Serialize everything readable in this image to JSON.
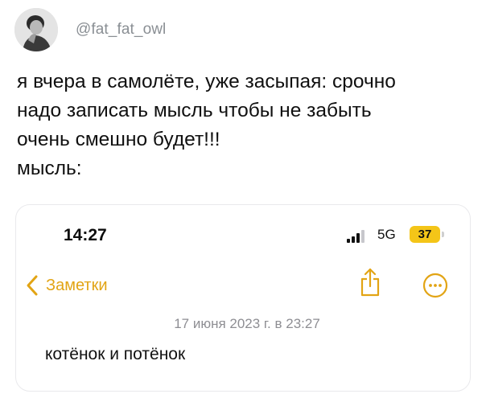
{
  "post": {
    "handle": "@fat_fat_owl",
    "lines": [
      "я вчера в самолёте, уже засыпая: срочно",
      "надо записать мысль чтобы не забыть",
      "очень смешно будет!!!",
      "мысль:"
    ]
  },
  "screenshot": {
    "status_bar": {
      "time": "14:27",
      "network": "5G",
      "battery": "37"
    },
    "nav": {
      "back_label": "Заметки"
    },
    "note": {
      "date": "17 июня 2023 г. в 23:27",
      "body": "котёнок и потёнок"
    }
  },
  "colors": {
    "accent": "#e2a414",
    "battery": "#f4c518",
    "handle": "#8a8f94",
    "date": "#8e8e93"
  },
  "icons": [
    "avatar",
    "signal-icon",
    "chevron-left-icon",
    "share-icon",
    "more-icon"
  ]
}
